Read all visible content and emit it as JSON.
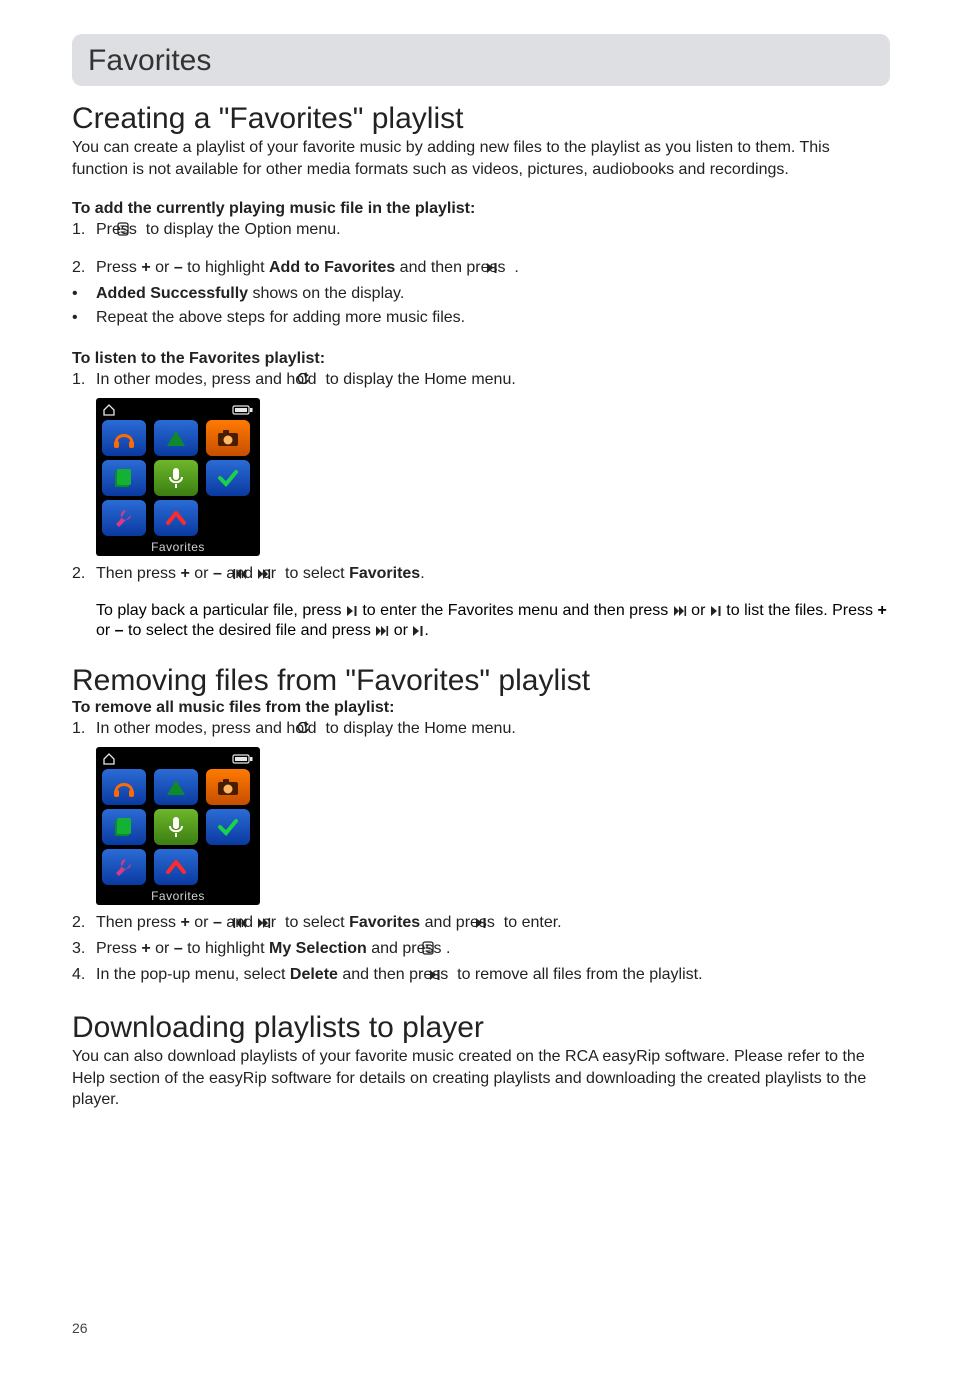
{
  "section_title": "Favorites",
  "h_create": "Creating a \"Favorites\" playlist",
  "p_create_intro": "You can create a playlist of your favorite music by adding new files to the playlist as you listen to them. This function is not available for other media formats such as videos, pictures, audiobooks and recordings.",
  "sub_add": "To add the currently playing music file in the playlist:",
  "add_step1_pre": "Press ",
  "add_step1_post": " to display the Option menu.",
  "add_step2_pre": "Press ",
  "add_step2_mid1": " or ",
  "add_step2_mid2": " to highlight ",
  "add_step2_bold": "Add to Favorites",
  "add_step2_post": " and then press ",
  "add_step2_end": " .",
  "plus": "+",
  "minus": "–",
  "add_bullet1_bold": "Added Successfully",
  "add_bullet1_rest": " shows on the display.",
  "add_bullet2": "Repeat the above steps for adding more music files.",
  "sub_listen": "To listen to the Favorites playlist:",
  "listen_step1_pre": "In other modes, press and hold ",
  "listen_step1_post": " to display the Home menu.",
  "home_label": "Favorites",
  "listen_step2_pre": "Then press ",
  "listen_step2_mid1": " or ",
  "listen_step2_mid2": " and ",
  "listen_step2_mid3": " or ",
  "listen_step2_mid4": " to select ",
  "listen_step2_bold": "Favorites",
  "listen_step2_end": ".",
  "listen_para_pre": "To play back a particular file, press ",
  "listen_para_mid1": " to enter the Favorites menu and then press ",
  "listen_para_mid2": " or ",
  "listen_para_mid3": " to list the files. Press ",
  "listen_para_mid4": " or ",
  "listen_para_mid5": " to select the desired file and press ",
  "listen_para_mid6": " or ",
  "listen_para_end": ".",
  "h_remove": "Removing files from \"Favorites\" playlist",
  "sub_remove": "To remove all music files from the playlist:",
  "remove_step1_pre": "In other modes, press and hold ",
  "remove_step1_post": " to display the Home menu.",
  "remove_step2_pre": "Then press ",
  "remove_step2_mid1": " or ",
  "remove_step2_mid2": " and ",
  "remove_step2_mid3": " or ",
  "remove_step2_mid4": " to select ",
  "remove_step2_bold": "Favorites",
  "remove_step2_post": " and press ",
  "remove_step2_end": " to enter.",
  "remove_step3_pre": "Press ",
  "remove_step3_mid1": " or ",
  "remove_step3_mid2": " to highlight ",
  "remove_step3_bold": "My Selection",
  "remove_step3_post": " and press ",
  "remove_step3_end": ".",
  "remove_step4_pre": "In the pop-up menu, select ",
  "remove_step4_bold": "Delete",
  "remove_step4_post": " and then press ",
  "remove_step4_end": " to remove all files from the playlist.",
  "h_download": "Downloading playlists to player",
  "p_download": "You can also download playlists of your favorite music created on the RCA easyRip software. Please refer to the Help section of the easyRip software for details on creating playlists and downloading the created playlists to the player.",
  "page_number": "26",
  "num1": "1.",
  "num2": "2.",
  "num3": "3.",
  "num4": "4.",
  "bullet": "•"
}
